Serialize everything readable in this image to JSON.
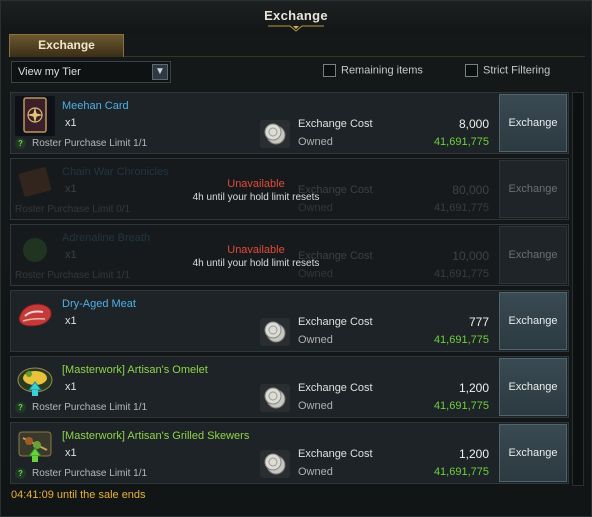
{
  "window": {
    "title": "Exchange"
  },
  "tabs": [
    {
      "label": "Exchange"
    }
  ],
  "controls": {
    "tier_select": "View my Tier",
    "remaining_items": "Remaining items",
    "strict_filtering": "Strict Filtering"
  },
  "common": {
    "exchange_cost": "Exchange Cost",
    "owned": "Owned",
    "exchange": "Exchange"
  },
  "items": [
    {
      "name": "Meehan Card",
      "qty": "x1",
      "limit": "Roster Purchase Limit 1/1",
      "cost": "8,000",
      "owned": "41,691,775",
      "available": true
    },
    {
      "name": "Chain War Chronicles",
      "qty": "x1",
      "limit": "Roster Purchase Limit 0/1",
      "cost": "80,000",
      "owned": "41,691,775",
      "available": false,
      "status": "Unavailable",
      "status_sub": "4h until your hold limit resets"
    },
    {
      "name": "Adrenaline Breath",
      "qty": "x1",
      "limit": "Roster Purchase Limit 1/1",
      "cost": "10,000",
      "owned": "41,691,775",
      "available": false,
      "status": "Unavailable",
      "status_sub": "4h until your hold limit resets"
    },
    {
      "name": "Dry-Aged Meat",
      "qty": "x1",
      "limit": "",
      "cost": "777",
      "owned": "41,691,775",
      "available": true
    },
    {
      "name": "[Masterwork] Artisan's Omelet",
      "qty": "x1",
      "limit": "Roster Purchase Limit 1/1",
      "cost": "1,200",
      "owned": "41,691,775",
      "available": true
    },
    {
      "name": "[Masterwork] Artisan's Grilled Skewers",
      "qty": "x1",
      "limit": "Roster Purchase Limit 1/1",
      "cost": "1,200",
      "owned": "41,691,775",
      "available": true
    }
  ],
  "footer": {
    "timer": "04:41:09 until the sale ends"
  },
  "icons": [
    "card-icon",
    "book-icon",
    "potion-icon",
    "meat-icon",
    "omelet-icon",
    "skewers-icon",
    "silver-coin-icon",
    "chevron-down-icon",
    "help-icon"
  ]
}
